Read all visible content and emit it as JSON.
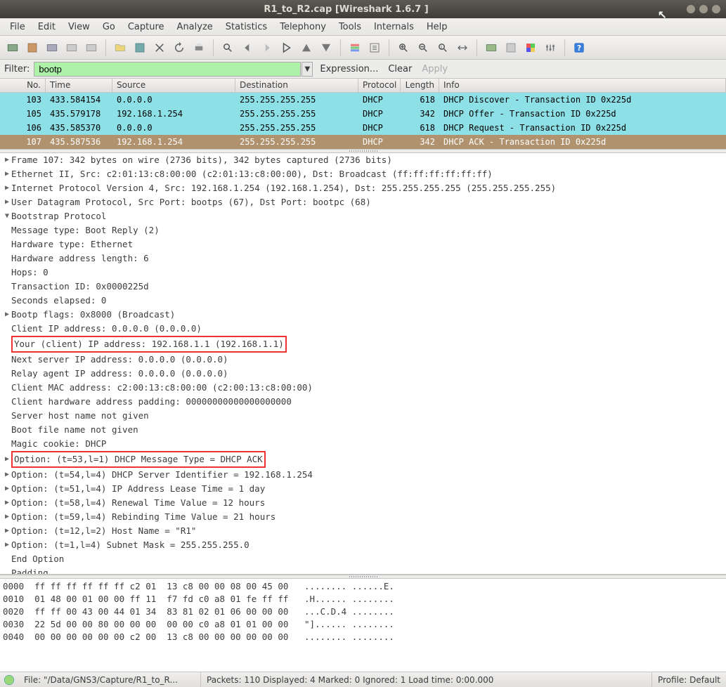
{
  "title": "R1_to_R2.cap   [Wireshark 1.6.7 ]",
  "menus": [
    "File",
    "Edit",
    "View",
    "Go",
    "Capture",
    "Analyze",
    "Statistics",
    "Telephony",
    "Tools",
    "Internals",
    "Help"
  ],
  "filter": {
    "label": "Filter:",
    "value": "bootp",
    "expression": "Expression...",
    "clear": "Clear",
    "apply": "Apply"
  },
  "columns": {
    "no": "No.",
    "time": "Time",
    "src": "Source",
    "dst": "Destination",
    "proto": "Protocol",
    "len": "Length",
    "info": "Info"
  },
  "packets": [
    {
      "no": "103",
      "time": "433.584154",
      "src": "0.0.0.0",
      "dst": "255.255.255.255",
      "proto": "DHCP",
      "len": "618",
      "info": "DHCP Discover - Transaction ID 0x225d",
      "class": "row-cyan"
    },
    {
      "no": "105",
      "time": "435.579178",
      "src": "192.168.1.254",
      "dst": "255.255.255.255",
      "proto": "DHCP",
      "len": "342",
      "info": "DHCP Offer    - Transaction ID 0x225d",
      "class": "row-cyan"
    },
    {
      "no": "106",
      "time": "435.585370",
      "src": "0.0.0.0",
      "dst": "255.255.255.255",
      "proto": "DHCP",
      "len": "618",
      "info": "DHCP Request  - Transaction ID 0x225d",
      "class": "row-cyan"
    },
    {
      "no": "107",
      "time": "435.587536",
      "src": "192.168.1.254",
      "dst": "255.255.255.255",
      "proto": "DHCP",
      "len": "342",
      "info": "DHCP ACK      - Transaction ID 0x225d",
      "class": "row-brown"
    }
  ],
  "details": [
    {
      "ind": 0,
      "tri": "▶",
      "text": "Frame 107: 342 bytes on wire (2736 bits), 342 bytes captured (2736 bits)"
    },
    {
      "ind": 0,
      "tri": "▶",
      "text": "Ethernet II, Src: c2:01:13:c8:00:00 (c2:01:13:c8:00:00), Dst: Broadcast (ff:ff:ff:ff:ff:ff)"
    },
    {
      "ind": 0,
      "tri": "▶",
      "text": "Internet Protocol Version 4, Src: 192.168.1.254 (192.168.1.254), Dst: 255.255.255.255 (255.255.255.255)"
    },
    {
      "ind": 0,
      "tri": "▶",
      "text": "User Datagram Protocol, Src Port: bootps (67), Dst Port: bootpc (68)"
    },
    {
      "ind": 0,
      "tri": "▼",
      "text": "Bootstrap Protocol"
    },
    {
      "ind": 1,
      "text": "Message type: Boot Reply (2)"
    },
    {
      "ind": 1,
      "text": "Hardware type: Ethernet"
    },
    {
      "ind": 1,
      "text": "Hardware address length: 6"
    },
    {
      "ind": 1,
      "text": "Hops: 0"
    },
    {
      "ind": 1,
      "text": "Transaction ID: 0x0000225d"
    },
    {
      "ind": 1,
      "text": "Seconds elapsed: 0"
    },
    {
      "ind": 1,
      "tri": "▶",
      "text": "Bootp flags: 0x8000 (Broadcast)"
    },
    {
      "ind": 1,
      "text": "Client IP address: 0.0.0.0 (0.0.0.0)"
    },
    {
      "ind": 1,
      "text": "Your (client) IP address: 192.168.1.1 (192.168.1.1)",
      "red": true
    },
    {
      "ind": 1,
      "text": "Next server IP address: 0.0.0.0 (0.0.0.0)"
    },
    {
      "ind": 1,
      "text": "Relay agent IP address: 0.0.0.0 (0.0.0.0)"
    },
    {
      "ind": 1,
      "text": "Client MAC address: c2:00:13:c8:00:00 (c2:00:13:c8:00:00)"
    },
    {
      "ind": 1,
      "text": "Client hardware address padding: 00000000000000000000"
    },
    {
      "ind": 1,
      "text": "Server host name not given"
    },
    {
      "ind": 1,
      "text": "Boot file name not given"
    },
    {
      "ind": 1,
      "text": "Magic cookie: DHCP"
    },
    {
      "ind": 1,
      "tri": "▶",
      "text": "Option: (t=53,l=1) DHCP Message Type = DHCP ACK",
      "red": true
    },
    {
      "ind": 1,
      "tri": "▶",
      "text": "Option: (t=54,l=4) DHCP Server Identifier = 192.168.1.254"
    },
    {
      "ind": 1,
      "tri": "▶",
      "text": "Option: (t=51,l=4) IP Address Lease Time = 1 day"
    },
    {
      "ind": 1,
      "tri": "▶",
      "text": "Option: (t=58,l=4) Renewal Time Value = 12 hours"
    },
    {
      "ind": 1,
      "tri": "▶",
      "text": "Option: (t=59,l=4) Rebinding Time Value = 21 hours"
    },
    {
      "ind": 1,
      "tri": "▶",
      "text": "Option: (t=12,l=2) Host Name = \"R1\""
    },
    {
      "ind": 1,
      "tri": "▶",
      "text": "Option: (t=1,l=4) Subnet Mask = 255.255.255.0"
    },
    {
      "ind": 1,
      "text": "End Option"
    },
    {
      "ind": 1,
      "text": "Padding"
    }
  ],
  "hex": [
    "0000  ff ff ff ff ff ff c2 01  13 c8 00 00 08 00 45 00   ........ ......E.",
    "0010  01 48 00 01 00 00 ff 11  f7 fd c0 a8 01 fe ff ff   .H...... ........",
    "0020  ff ff 00 43 00 44 01 34  83 81 02 01 06 00 00 00   ...C.D.4 ........",
    "0030  22 5d 00 00 80 00 00 00  00 00 c0 a8 01 01 00 00   \"]...... ........",
    "0040  00 00 00 00 00 00 c2 00  13 c8 00 00 00 00 00 00   ........ ........"
  ],
  "status": {
    "file": "File: \"/Data/GNS3/Capture/R1_to_R...",
    "mid": "Packets: 110 Displayed: 4 Marked: 0 Ignored: 1 Load time: 0:00.000",
    "profile": "Profile: Default"
  }
}
